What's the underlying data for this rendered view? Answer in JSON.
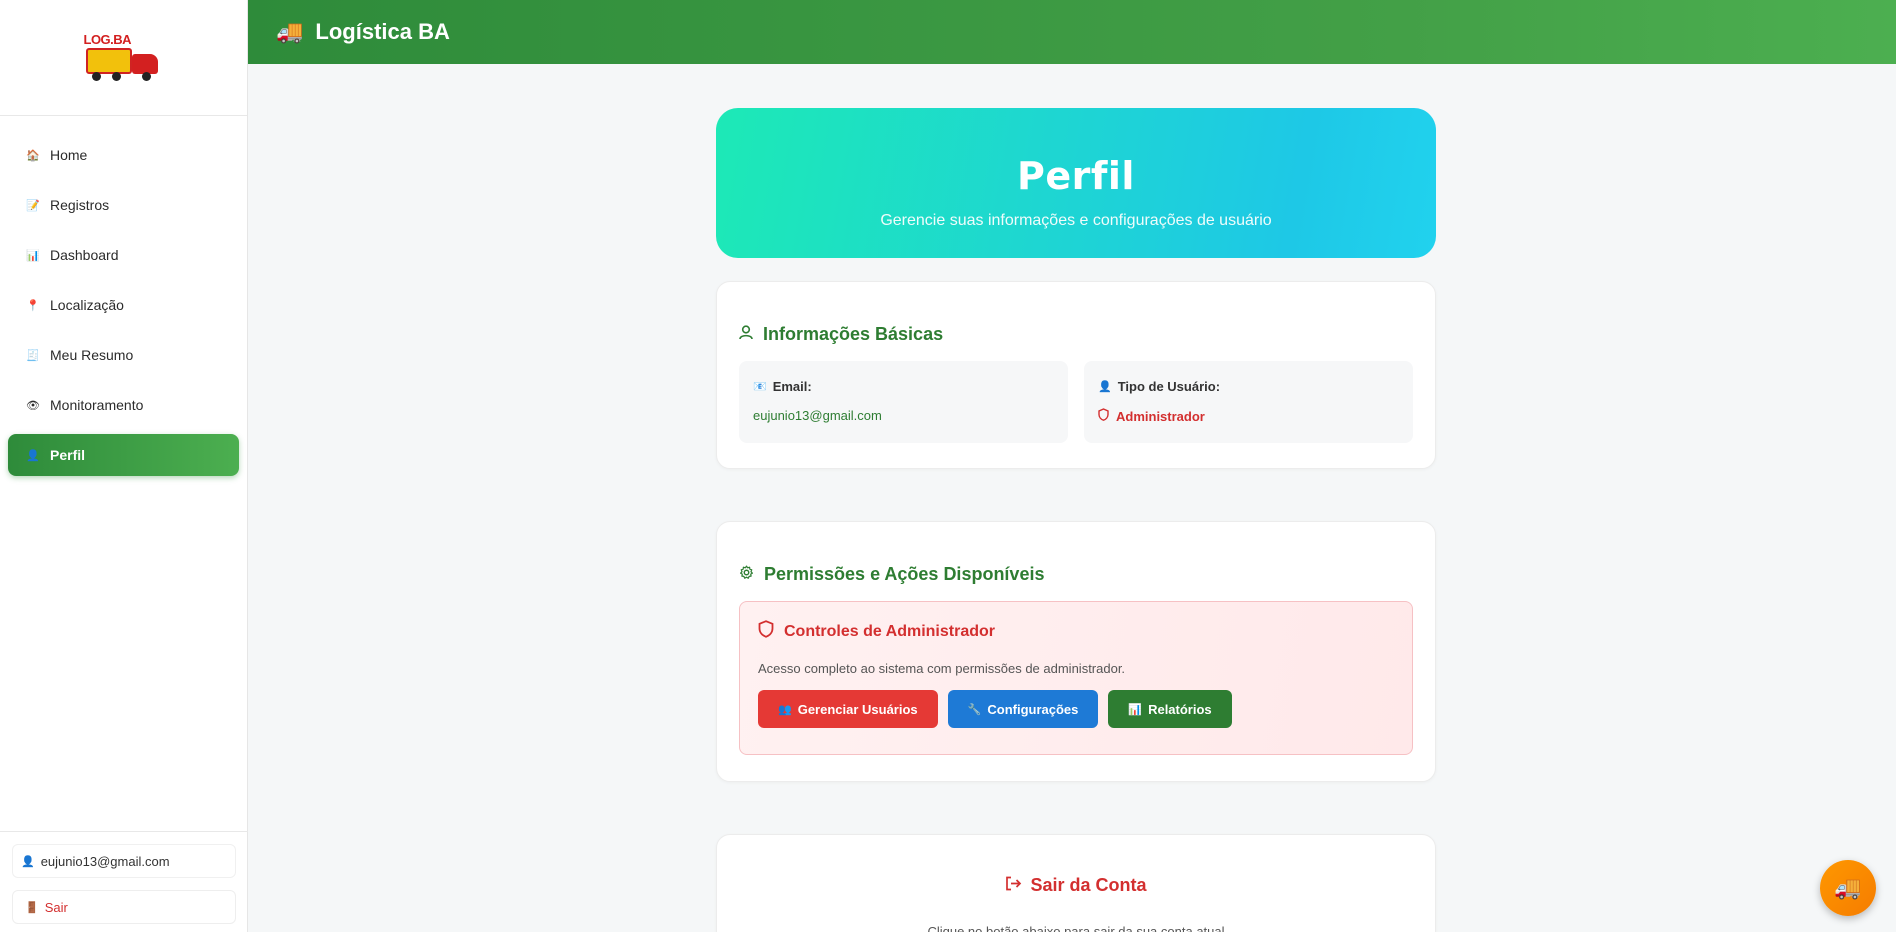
{
  "app": {
    "title": "Logística BA",
    "brand_logo_text": "LOG.BA",
    "title_icon": "truck-icon"
  },
  "sidebar": {
    "items": [
      {
        "label": "Home",
        "icon": "house-icon",
        "active": false
      },
      {
        "label": "Registros",
        "icon": "memo-icon",
        "active": false
      },
      {
        "label": "Dashboard",
        "icon": "bar-chart-icon",
        "active": false
      },
      {
        "label": "Localização",
        "icon": "pin-icon",
        "active": false
      },
      {
        "label": "Meu Resumo",
        "icon": "receipt-icon",
        "active": false
      },
      {
        "label": "Monitoramento",
        "icon": "eye-icon",
        "active": false
      },
      {
        "label": "Perfil",
        "icon": "user-icon",
        "active": true
      }
    ],
    "user_email": "eujunio13@gmail.com",
    "logout_label": "Sair"
  },
  "hero": {
    "title": "Perfil",
    "subtitle": "Gerencie suas informações e configurações de usuário"
  },
  "basic_info": {
    "title": "Informações Básicas",
    "email_label": "Email:",
    "email_value": "eujunio13@gmail.com",
    "type_label": "Tipo de Usuário:",
    "type_value": "Administrador"
  },
  "permissions": {
    "title": "Permissões e Ações Disponíveis",
    "admin_title": "Controles de Administrador",
    "admin_desc": "Acesso completo ao sistema com permissões de administrador.",
    "buttons": {
      "manage_users": "Gerenciar Usuários",
      "settings": "Configurações",
      "reports": "Relatórios"
    }
  },
  "logout": {
    "title": "Sair da Conta",
    "desc": "Clique no botão abaixo para sair da sua conta atual"
  },
  "colors": {
    "primary_green": "#2e7d32",
    "hero_start": "#1de9b6",
    "hero_end": "#1ec8e6",
    "danger": "#d32f2f",
    "info": "#1e7ad6",
    "fab": "#f57c00"
  }
}
